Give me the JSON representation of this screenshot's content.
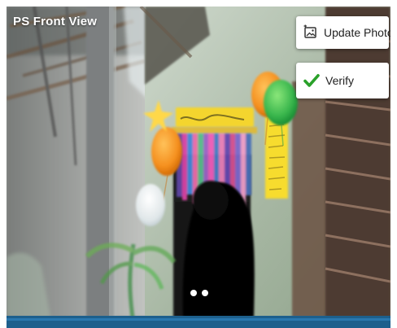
{
  "header": {
    "title": "PS Front View"
  },
  "actions": {
    "update_photo": {
      "label": "Update Photo",
      "icon": "photo-icon"
    },
    "verify": {
      "label": "Verify",
      "icon": "check-icon",
      "color": "#2aa12a"
    }
  },
  "photo": {
    "scene": "classroom-doorway-preview",
    "dots_count": 2
  },
  "colors": {
    "bottom_bar": "#1d5f8c",
    "verify_check": "#2aa12a"
  }
}
